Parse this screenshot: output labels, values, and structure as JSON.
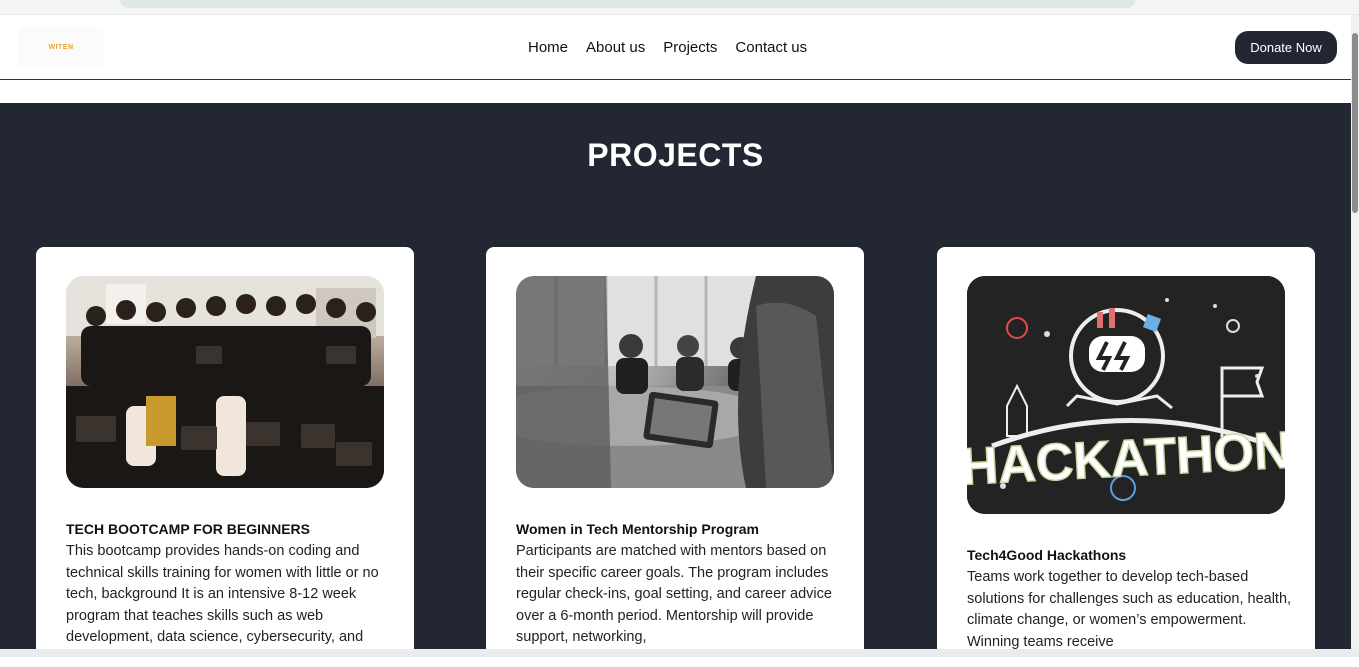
{
  "logo": {
    "text": "WITEN"
  },
  "nav": {
    "items": [
      "Home",
      "About us",
      "Projects",
      "Contact us"
    ]
  },
  "header": {
    "donate_label": "Donate Now"
  },
  "projects": {
    "title": "PROJECTS",
    "cards": [
      {
        "title": "TECH BOOTCAMP FOR BEGINNERS",
        "text": "This bootcamp provides hands-on coding and technical skills training for women with little or no tech, background It is an intensive 8-12 week program that teaches skills such as web development, data science, cybersecurity, and"
      },
      {
        "title": "Women in Tech Mentorship Program",
        "text": "Participants are matched with mentors based on their specific career goals. The program includes regular check-ins, goal setting, and career advice over a 6-month period. Mentorship will provide support, networking,"
      },
      {
        "title": "Tech4Good Hackathons",
        "text": "Teams work together to develop tech-based solutions for challenges such as education, health, climate change, or women’s empowerment. Winning teams receive",
        "image_text": "HACKATHON"
      }
    ]
  },
  "colors": {
    "dark_bg": "#222733",
    "accent_logo": "#e8a030"
  }
}
